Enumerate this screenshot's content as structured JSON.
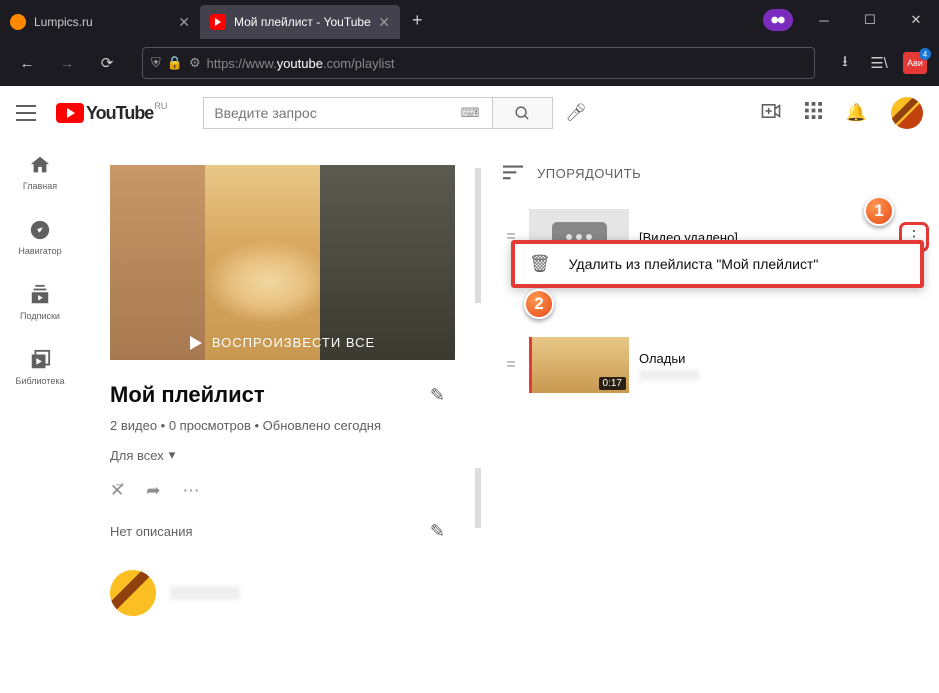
{
  "tabs": {
    "t1": "Lumpics.ru",
    "t2": "Мой плейлист - YouTube"
  },
  "url": {
    "pre": "https://www.",
    "dom": "youtube",
    "post": ".com/playlist"
  },
  "search": {
    "placeholder": "Введите запрос"
  },
  "yt": {
    "brand": "YouTube",
    "region": "RU"
  },
  "sidebar": {
    "home": "Главная",
    "explore": "Навигатор",
    "subs": "Подписки",
    "lib": "Библиотека"
  },
  "playlist": {
    "playall": "ВОСПРОИЗВЕСТИ ВСЕ",
    "title": "Мой плейлист",
    "meta": "2 видео • 0 просмотров • Обновлено сегодня",
    "visibility": "Для всех",
    "nodesc": "Нет описания"
  },
  "sort": {
    "label": "УПОРЯДОЧИТЬ"
  },
  "items": {
    "deleted": "[Видео удалено]",
    "v2": "Оладьи",
    "dur2": "0:17"
  },
  "menu": {
    "remove": "Удалить из плейлиста \"Мой плейлист\""
  },
  "callouts": {
    "one": "1",
    "two": "2"
  },
  "ext": {
    "badge": "Ави"
  }
}
